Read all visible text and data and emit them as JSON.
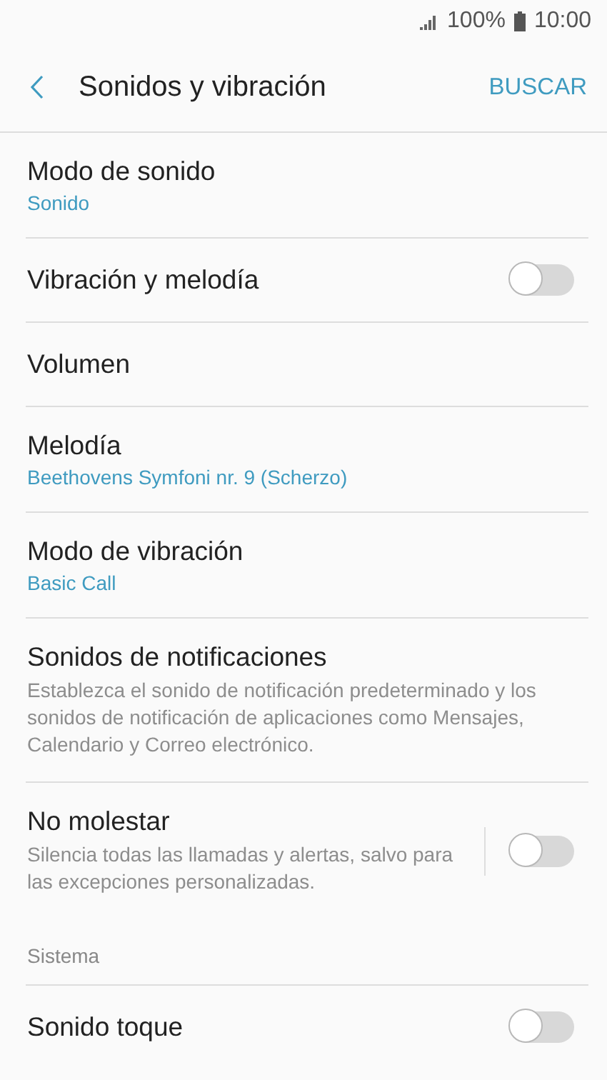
{
  "status_bar": {
    "battery": "100%",
    "time": "10:00"
  },
  "header": {
    "title": "Sonidos y vibración",
    "action": "BUSCAR"
  },
  "items": [
    {
      "kind": "value",
      "title": "Modo de sonido",
      "value": "Sonido"
    },
    {
      "kind": "toggle",
      "title": "Vibración y melodía",
      "on": false
    },
    {
      "kind": "plain",
      "title": "Volumen"
    },
    {
      "kind": "value",
      "title": "Melodía",
      "value": "Beethovens Symfoni nr. 9 (Scherzo)"
    },
    {
      "kind": "value",
      "title": "Modo de vibración",
      "value": "Basic Call"
    },
    {
      "kind": "description",
      "title": "Sonidos de notificaciones",
      "summary": "Establezca el sonido de notificación predeterminado y los sonidos de notificación de aplicaciones como Mensajes, Calendario y Correo electrónico."
    },
    {
      "kind": "toggle",
      "title": "No molestar",
      "summary": "Silencia todas las llamadas y alertas, salvo para las excepciones personalizadas.",
      "on": false
    }
  ],
  "section": {
    "title": "Sistema",
    "items": [
      {
        "kind": "toggle",
        "title": "Sonido toque",
        "on": false
      }
    ]
  }
}
